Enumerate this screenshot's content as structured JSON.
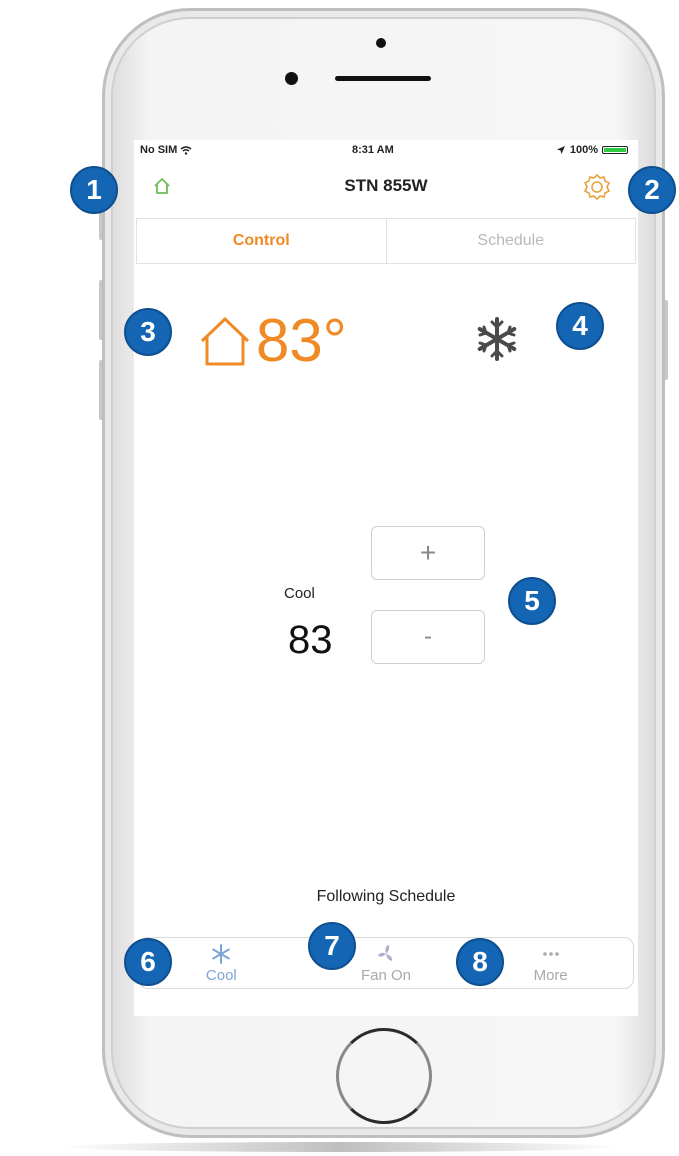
{
  "status_bar": {
    "carrier": "No SIM",
    "wifi": "wifi-icon",
    "time": "8:31 AM",
    "location": "location-icon",
    "battery_label": "100%"
  },
  "nav": {
    "title": "STN 855W"
  },
  "tabs": [
    {
      "label": "Control",
      "active": true
    },
    {
      "label": "Schedule",
      "active": false
    }
  ],
  "current": {
    "temperature": "83°",
    "mode_icon": "snowflake-icon"
  },
  "setpoint": {
    "mode_label": "Cool",
    "value": "83",
    "increment": "+",
    "decrement": "-"
  },
  "schedule_status": "Following Schedule",
  "bottom_tabs": [
    {
      "label": "Cool",
      "icon": "snowflake-icon"
    },
    {
      "label": "Fan On",
      "icon": "fan-icon"
    },
    {
      "label": "More",
      "icon": "more-icon"
    }
  ],
  "callouts": [
    "1",
    "2",
    "3",
    "4",
    "5",
    "6",
    "7",
    "8"
  ],
  "colors": {
    "accent": "#f08a24",
    "callout": "#1565b5",
    "cool": "#7da4d6"
  }
}
